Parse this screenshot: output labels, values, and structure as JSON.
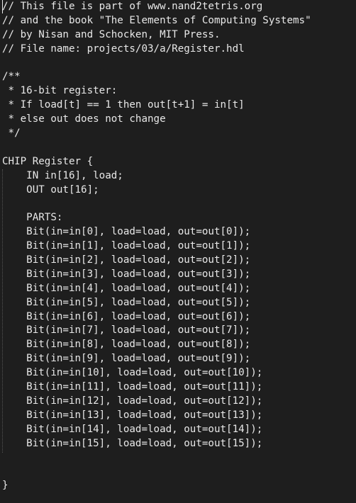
{
  "editor": {
    "lines": [
      "// This file is part of www.nand2tetris.org",
      "// and the book \"The Elements of Computing Systems\"",
      "// by Nisan and Schocken, MIT Press.",
      "// File name: projects/03/a/Register.hdl",
      "",
      "/**",
      " * 16-bit register:",
      " * If load[t] == 1 then out[t+1] = in[t]",
      " * else out does not change",
      " */",
      "",
      "CHIP Register {",
      "    IN in[16], load;",
      "    OUT out[16];",
      "",
      "    PARTS:",
      "    Bit(in=in[0], load=load, out=out[0]);",
      "    Bit(in=in[1], load=load, out=out[1]);",
      "    Bit(in=in[2], load=load, out=out[2]);",
      "    Bit(in=in[3], load=load, out=out[3]);",
      "    Bit(in=in[4], load=load, out=out[4]);",
      "    Bit(in=in[5], load=load, out=out[5]);",
      "    Bit(in=in[6], load=load, out=out[6]);",
      "    Bit(in=in[7], load=load, out=out[7]);",
      "    Bit(in=in[8], load=load, out=out[8]);",
      "    Bit(in=in[9], load=load, out=out[9]);",
      "    Bit(in=in[10], load=load, out=out[10]);",
      "    Bit(in=in[11], load=load, out=out[11]);",
      "    Bit(in=in[12], load=load, out=out[12]);",
      "    Bit(in=in[13], load=load, out=out[13]);",
      "    Bit(in=in[14], load=load, out=out[14]);",
      "    Bit(in=in[15], load=load, out=out[15]);",
      "",
      "",
      "}"
    ]
  }
}
